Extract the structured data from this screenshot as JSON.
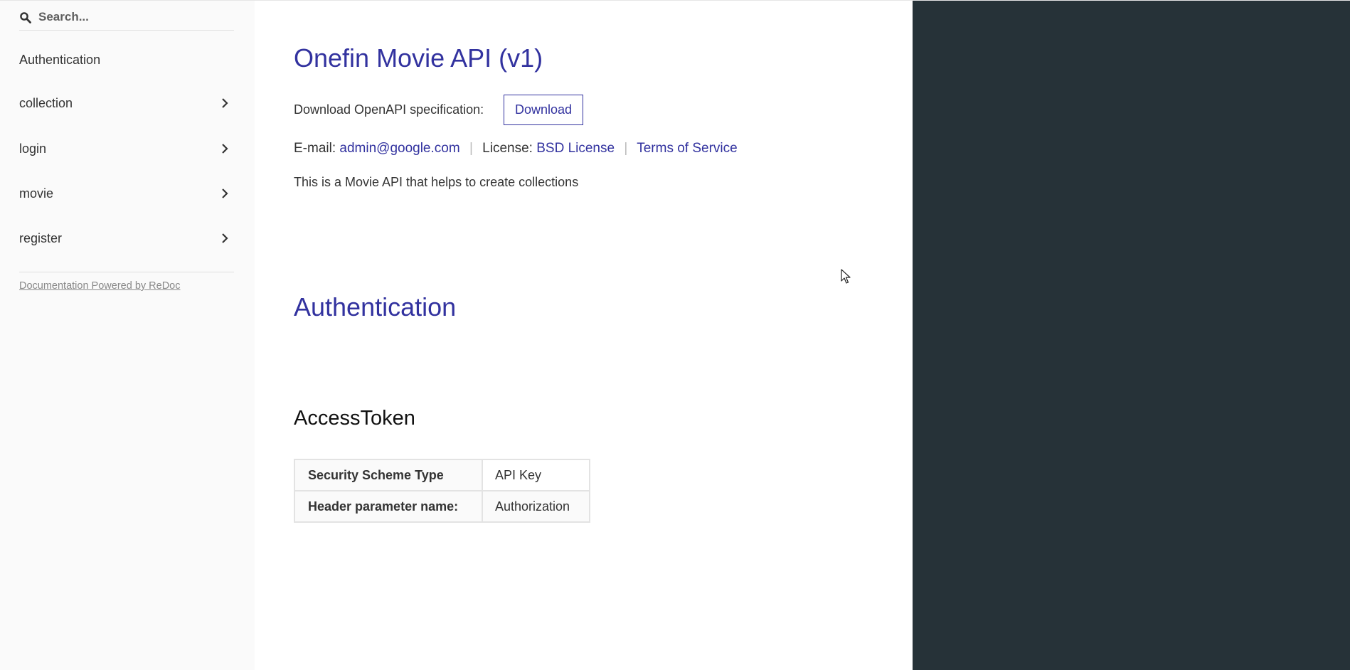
{
  "sidebar": {
    "search": {
      "placeholder": "Search...",
      "value": ""
    },
    "items": [
      {
        "label": "Authentication",
        "has_children": false
      },
      {
        "label": "collection",
        "has_children": true
      },
      {
        "label": "login",
        "has_children": true
      },
      {
        "label": "movie",
        "has_children": true
      },
      {
        "label": "register",
        "has_children": true
      }
    ],
    "powered_by": "Documentation Powered by ReDoc"
  },
  "main": {
    "title": "Onefin Movie API (v1)",
    "download": {
      "label": "Download OpenAPI specification:",
      "button": "Download"
    },
    "info": {
      "email_label": "E-mail:",
      "email": "admin@google.com",
      "separator": "|",
      "license_label": "License:",
      "license": "BSD License",
      "terms": "Terms of Service"
    },
    "description": "This is a Movie API that helps to create collections",
    "auth_section": {
      "title": "Authentication",
      "scheme": {
        "name": "AccessToken",
        "rows": [
          {
            "key": "Security Scheme Type",
            "value": "API Key"
          },
          {
            "key": "Header parameter name:",
            "value": "Authorization"
          }
        ]
      }
    }
  },
  "colors": {
    "accent": "#32329f",
    "sidebar_bg": "#fafafa",
    "right_panel_bg": "#263238",
    "text": "#333333"
  },
  "icons": {
    "search": "search-icon",
    "chevron": "chevron-right-icon",
    "cursor": "mouse-pointer-icon"
  }
}
